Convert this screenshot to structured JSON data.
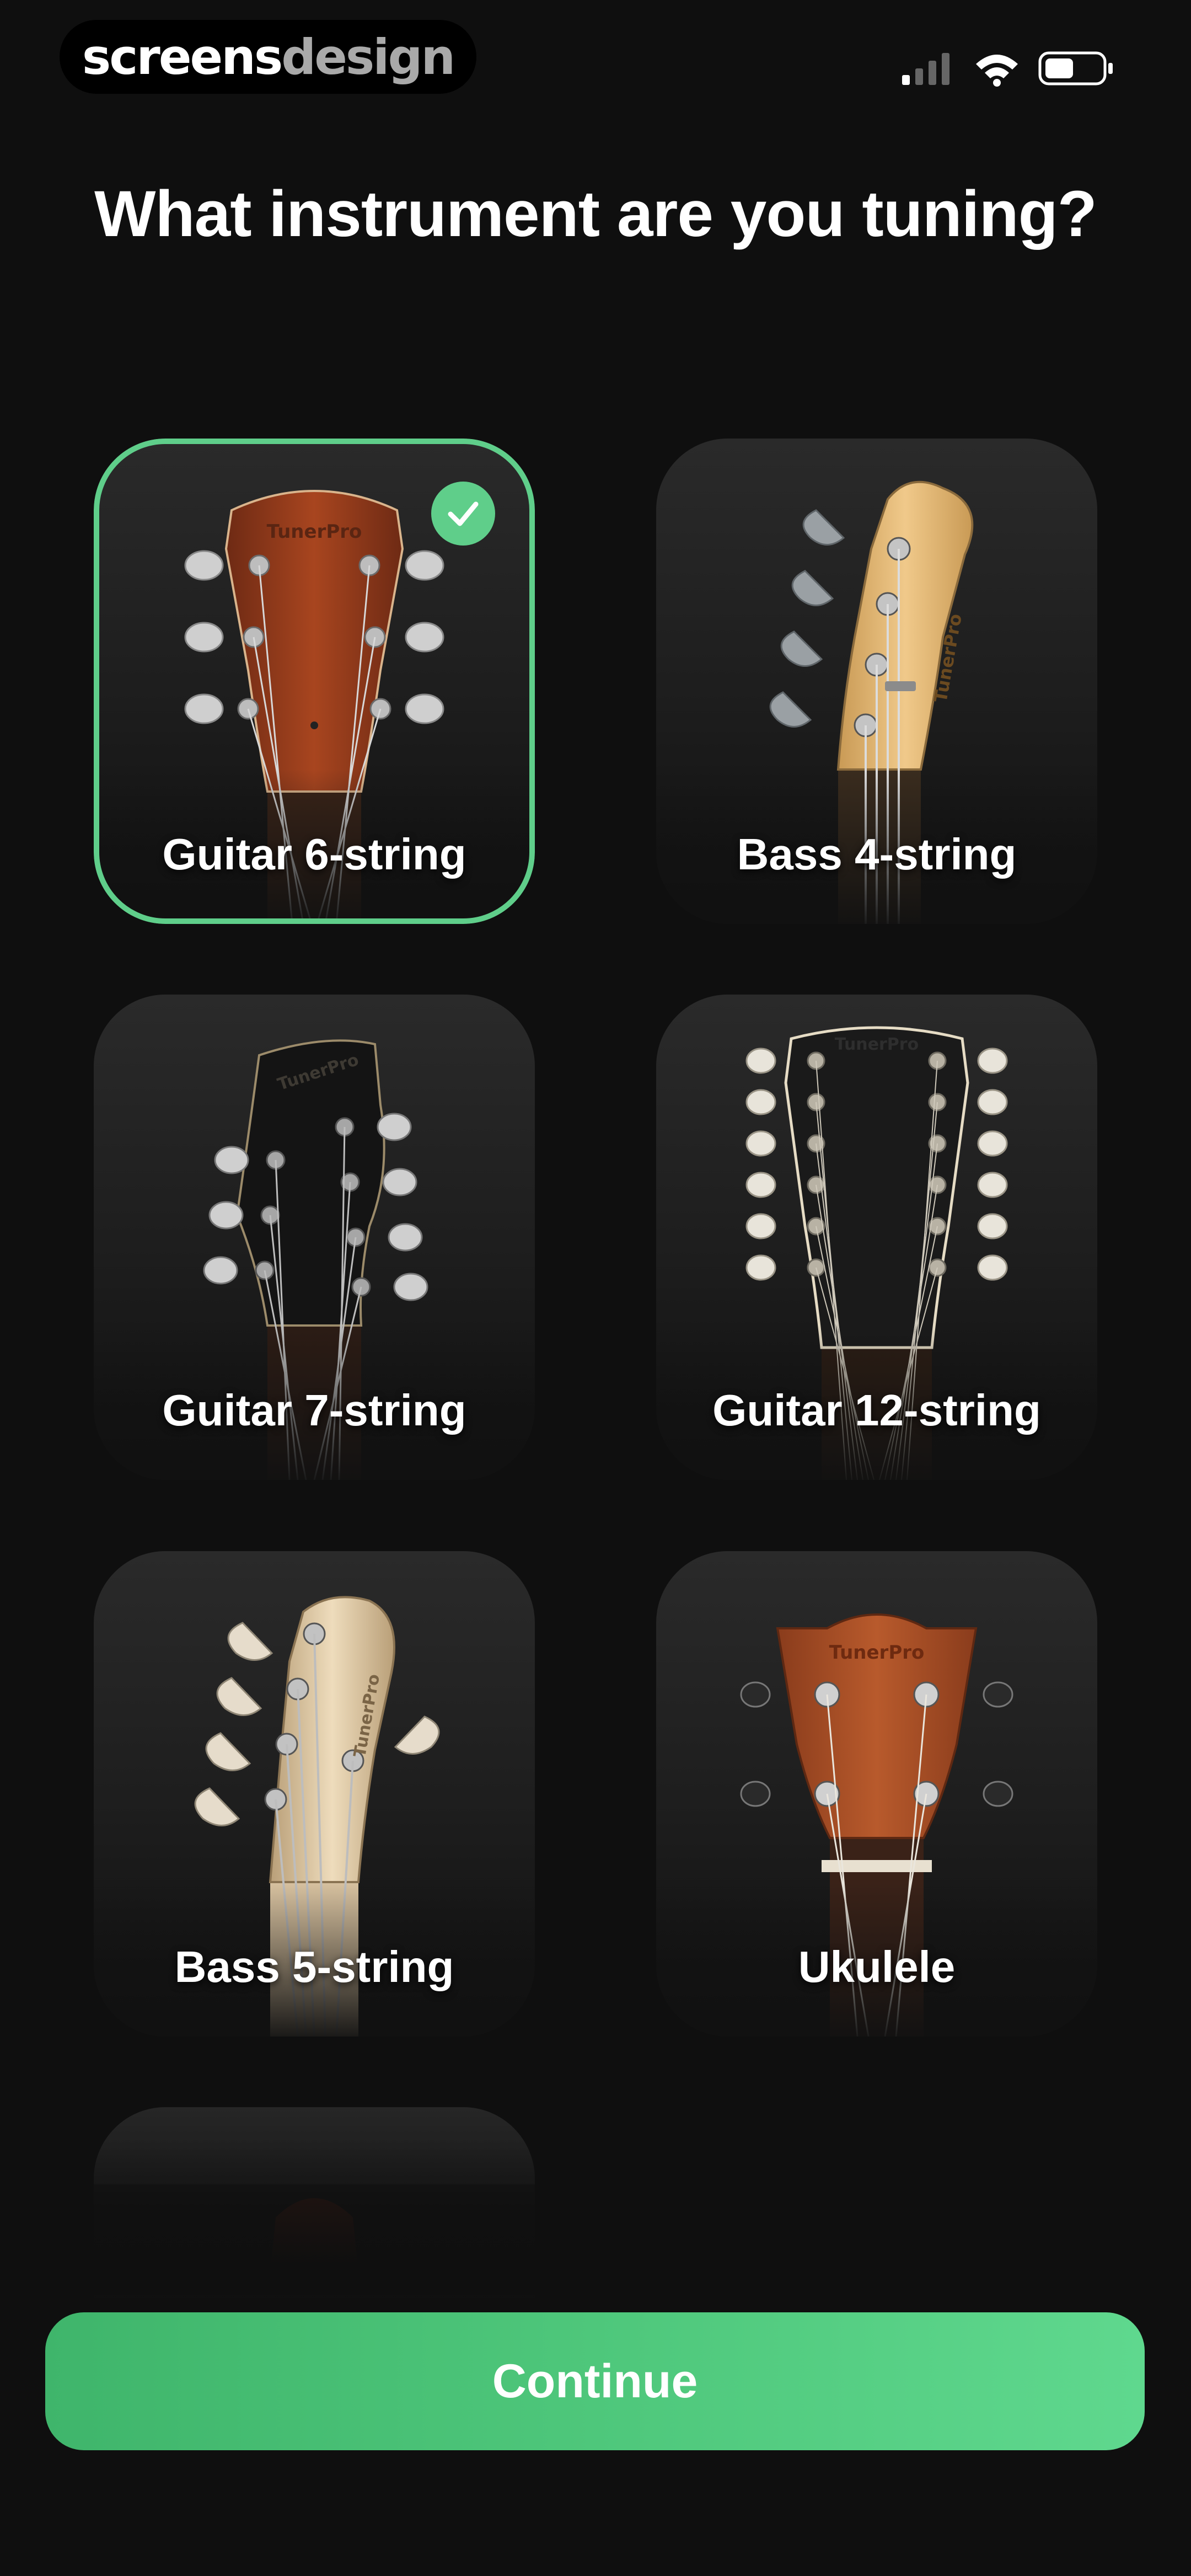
{
  "status_bar": {
    "logo_part1": "screens",
    "logo_part2": "design"
  },
  "header": {
    "title": "What instrument are you tuning?"
  },
  "instruments": [
    {
      "label": "Guitar 6-string",
      "selected": true,
      "headstock_brand": "TunerPro"
    },
    {
      "label": "Bass 4-string",
      "selected": false,
      "headstock_brand": "TunerPro"
    },
    {
      "label": "Guitar 7-string",
      "selected": false,
      "headstock_brand": "TunerPro"
    },
    {
      "label": "Guitar 12-string",
      "selected": false,
      "headstock_brand": "TunerPro"
    },
    {
      "label": "Bass 5-string",
      "selected": false,
      "headstock_brand": "TunerPro"
    },
    {
      "label": "Ukulele",
      "selected": false,
      "headstock_brand": "TunerPro"
    }
  ],
  "footer": {
    "continue_label": "Continue"
  },
  "colors": {
    "accent": "#5fce8a",
    "background": "#0f0f0f",
    "card": "#222222"
  },
  "icons": [
    "cellular-signal-icon",
    "wifi-icon",
    "battery-icon",
    "checkmark-icon"
  ]
}
